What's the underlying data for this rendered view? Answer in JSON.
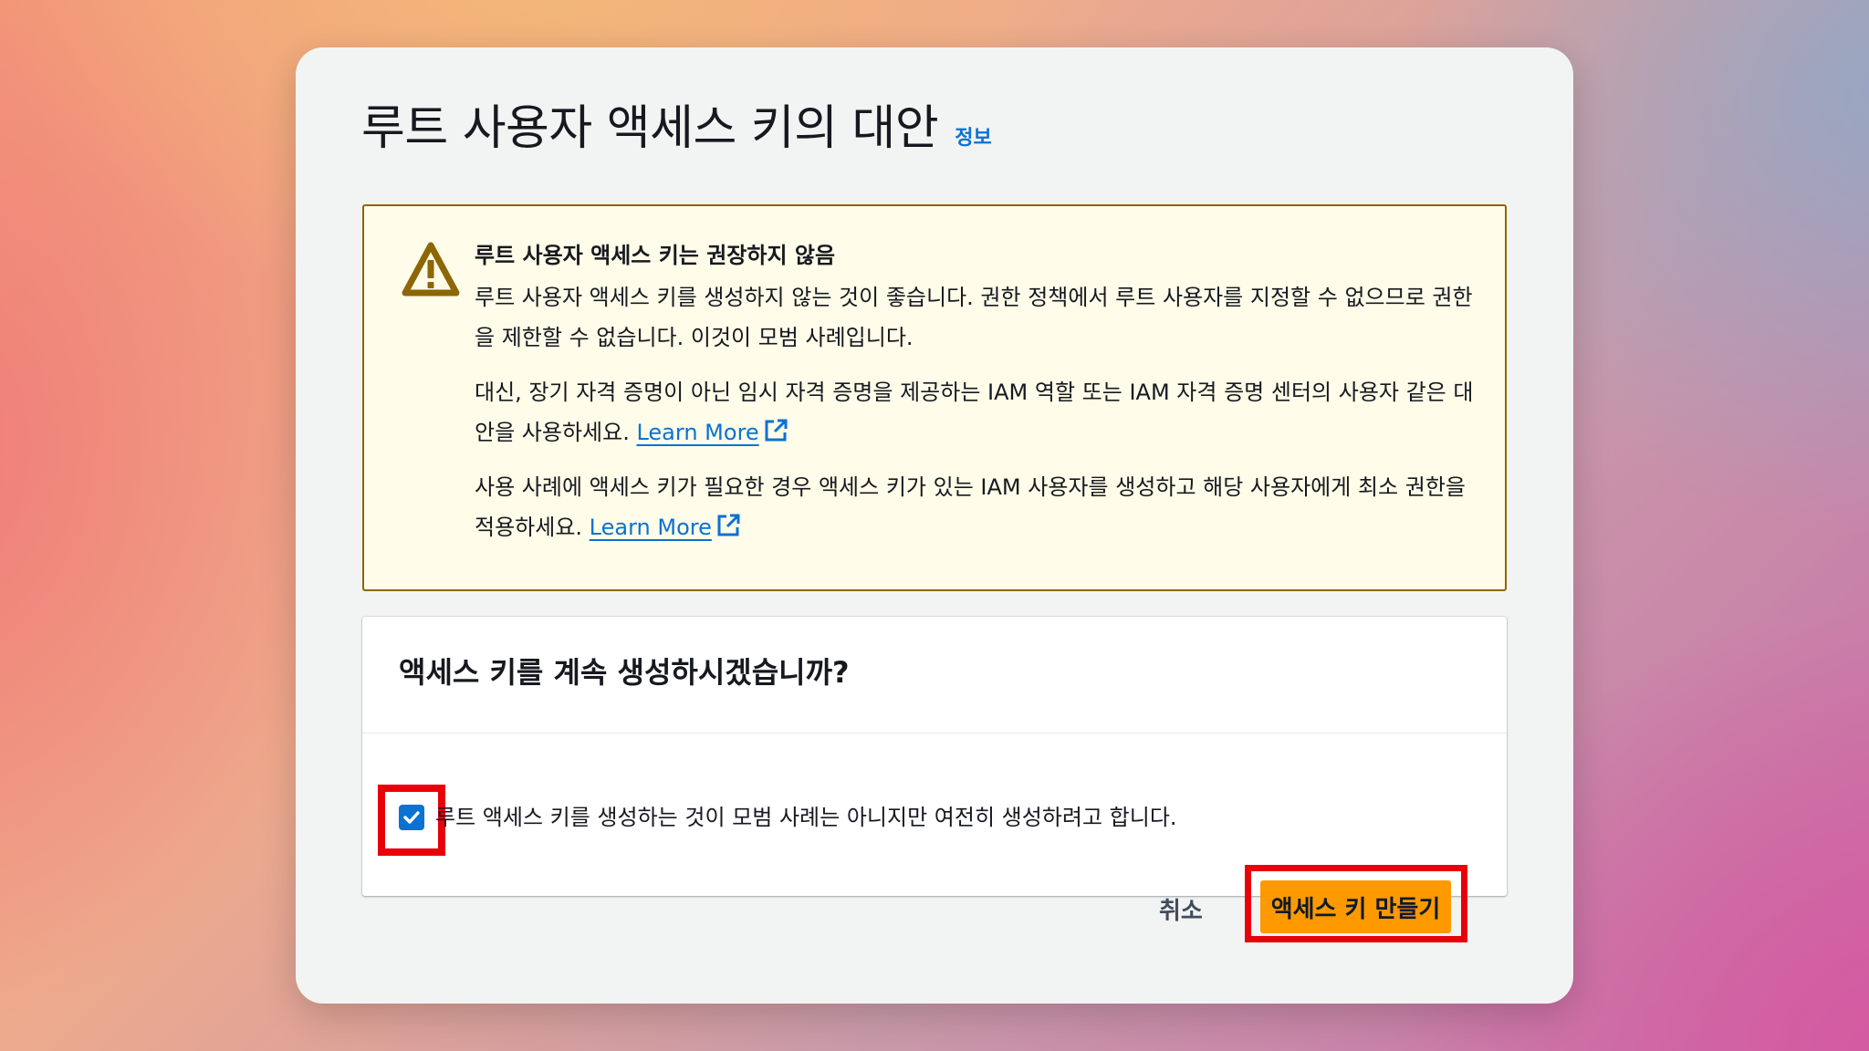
{
  "dialog": {
    "title": "루트 사용자 액세스 키의 대안",
    "info_link": "정보"
  },
  "warning": {
    "icon": "warning-triangle-icon",
    "heading": "루트 사용자 액세스 키는 권장하지 않음",
    "para1": "루트 사용자 액세스 키를 생성하지 않는 것이 좋습니다. 권한 정책에서 루트 사용자를 지정할 수 없으므로 권한을 제한할 수 없습니다. 이것이 모범 사례입니다.",
    "para2": "대신, 장기 자격 증명이 아닌 임시 자격 증명을 제공하는 IAM 역할 또는 IAM 자격 증명 센터의 사용자 같은 대안을 사용하세요.",
    "para2_link": "Learn More",
    "para3": "사용 사례에 액세스 키가 필요한 경우 액세스 키가 있는 IAM 사용자를 생성하고 해당 사용자에게 최소 권한을 적용하세요.",
    "para3_link": "Learn More",
    "link_icon": "external-link-icon"
  },
  "confirm": {
    "title": "액세스 키를 계속 생성하시겠습니까?",
    "checkbox_label": "루트 액세스 키를 생성하는 것이 모범 사례는 아니지만 여전히 생성하려고 합니다.",
    "checkbox_checked": true
  },
  "footer": {
    "cancel_label": "취소",
    "create_label": "액세스 키 만들기"
  },
  "colors": {
    "primary_button": "#ff9900",
    "link": "#0972d3",
    "warning_border": "#8d6605",
    "warning_bg": "#fffce9",
    "highlight": "#e8000b"
  }
}
